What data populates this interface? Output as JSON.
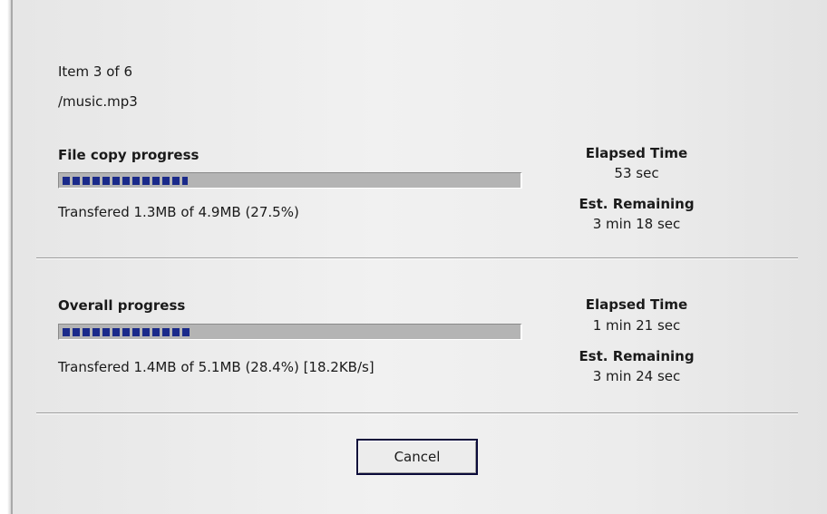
{
  "header": {
    "item_counter": "Item 3 of 6",
    "file_path": "/music.mp3"
  },
  "file_copy": {
    "title": "File copy progress",
    "progress": 0.275,
    "status": "Transfered 1.3MB of 4.9MB (27.5%)",
    "elapsed_label": "Elapsed Time",
    "elapsed_value": "53 sec",
    "remaining_label": "Est. Remaining",
    "remaining_value": "3 min 18 sec"
  },
  "overall": {
    "title": "Overall progress",
    "progress": 0.284,
    "status": "Transfered 1.4MB of 5.1MB (28.4%)  [18.2KB/s]",
    "elapsed_label": "Elapsed Time",
    "elapsed_value": "1 min 21 sec",
    "remaining_label": "Est. Remaining",
    "remaining_value": "3 min 24 sec"
  },
  "actions": {
    "cancel_label": "Cancel"
  },
  "colors": {
    "bar_fill": "#1a2a8a",
    "bar_track": "#b4b4b4",
    "button_border": "#0a0a3a"
  }
}
